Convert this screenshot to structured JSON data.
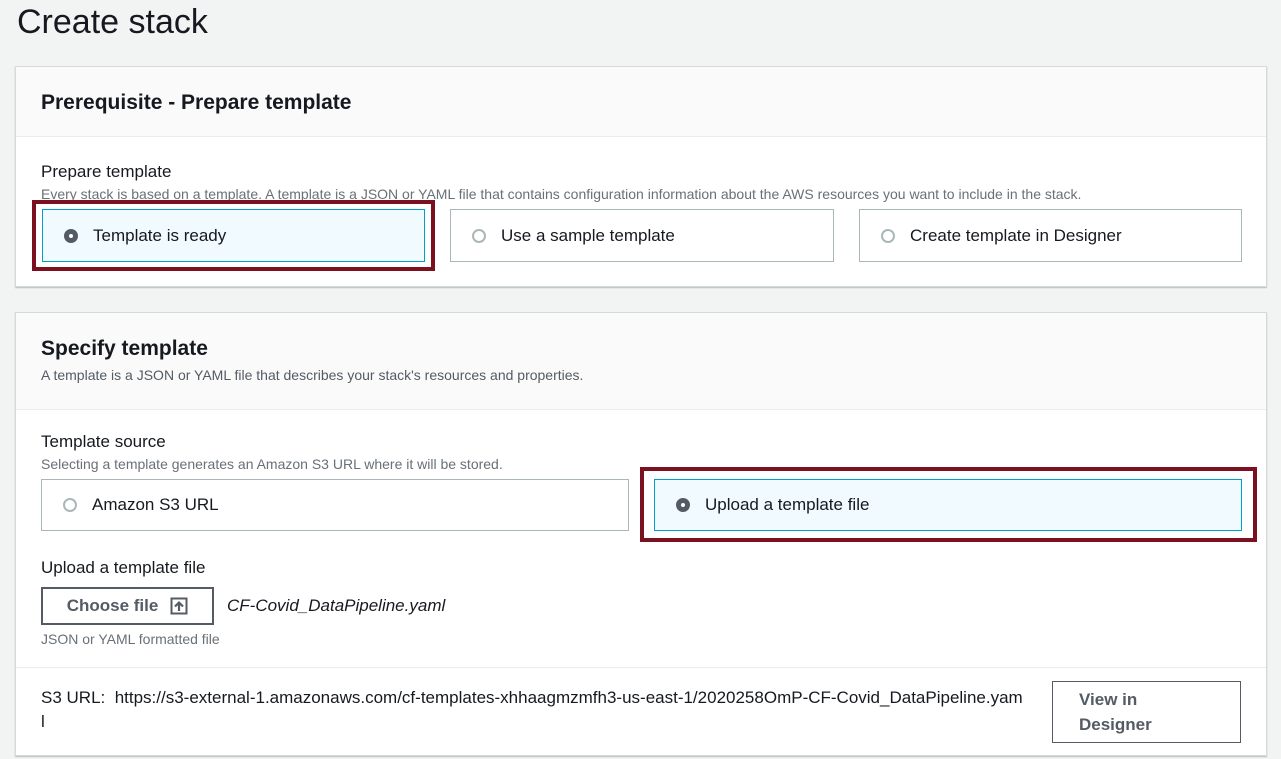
{
  "page": {
    "title": "Create stack"
  },
  "prerequisite": {
    "title": "Prerequisite - Prepare template",
    "field_label": "Prepare template",
    "field_description": "Every stack is based on a template. A template is a JSON or YAML file that contains configuration information about the AWS resources you want to include in the stack.",
    "options": [
      {
        "label": "Template is ready",
        "selected": true
      },
      {
        "label": "Use a sample template",
        "selected": false
      },
      {
        "label": "Create template in Designer",
        "selected": false
      }
    ]
  },
  "specify": {
    "title": "Specify template",
    "description": "A template is a JSON or YAML file that describes your stack's resources and properties.",
    "source_label": "Template source",
    "source_description": "Selecting a template generates an Amazon S3 URL where it will be stored.",
    "options": [
      {
        "label": "Amazon S3 URL",
        "selected": false
      },
      {
        "label": "Upload a template file",
        "selected": true
      }
    ],
    "upload_label": "Upload a template file",
    "choose_file_label": "Choose file",
    "file_name": "CF-Covid_DataPipeline.yaml",
    "file_constraint": "JSON or YAML formatted file",
    "s3_url_label": "S3 URL:",
    "s3_url_value": "https://s3-external-1.amazonaws.com/cf-templates-xhhaagmzmfh3-us-east-1/2020258OmP-CF-Covid_DataPipeline.yaml",
    "view_designer_label": "View in Designer"
  },
  "colors": {
    "highlight": "#7b1020",
    "selected_tile_bg": "#f1faff",
    "selected_tile_border": "#00a1c9"
  }
}
